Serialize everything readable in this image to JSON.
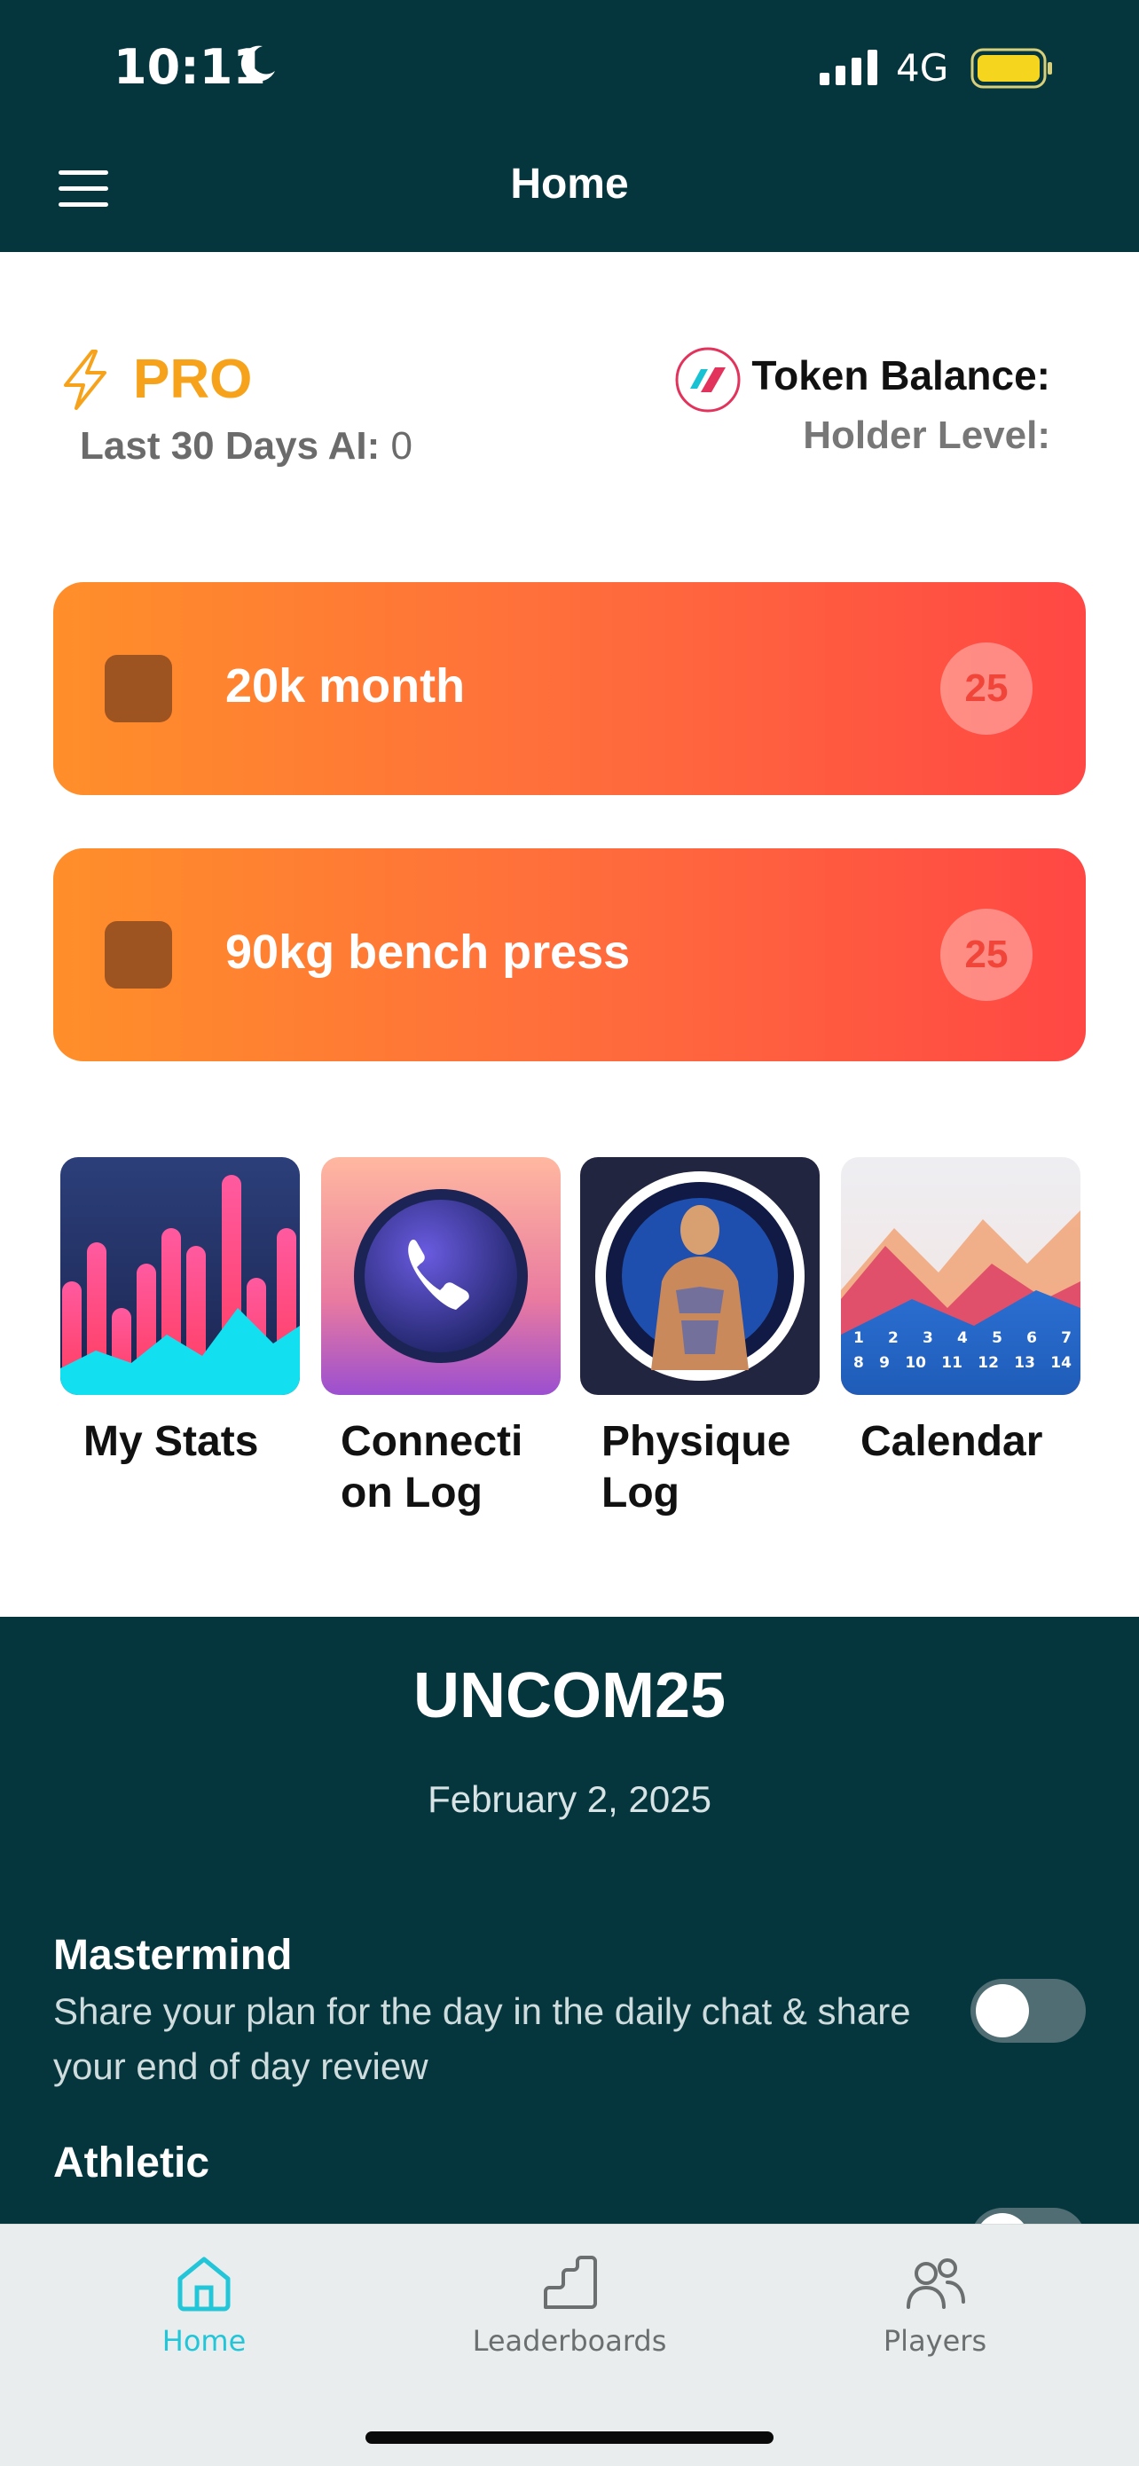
{
  "status_bar": {
    "time": "10:11",
    "network": "4G"
  },
  "header": {
    "title": "Home"
  },
  "pro_panel": {
    "badge": "PRO",
    "ai_label": "Last 30 Days AI:",
    "ai_value": "0",
    "token_balance_label": "Token Balance:",
    "holder_level_label": "Holder Level:"
  },
  "goals": [
    {
      "label": "20k month",
      "count": "25"
    },
    {
      "label": "90kg bench press",
      "count": "25"
    }
  ],
  "tiles": [
    {
      "label": "My Stats"
    },
    {
      "label": "Connecti\non Log"
    },
    {
      "label": "Physique\nLog"
    },
    {
      "label": "Calendar"
    }
  ],
  "calendar_days": [
    "1",
    "2",
    "3",
    "4",
    "5",
    "6",
    "7",
    "8",
    "9",
    "10",
    "11",
    "12",
    "13",
    "14"
  ],
  "challenge": {
    "title": "UNCOM25",
    "date": "February 2, 2025",
    "tasks": [
      {
        "title": "Mastermind",
        "description": "Share your plan for the day in the daily chat & share your end of day review"
      },
      {
        "title": "Athletic"
      }
    ]
  },
  "tabbar": {
    "tabs": [
      {
        "label": "Home",
        "icon": "home-icon",
        "active": true
      },
      {
        "label": "Leaderboards",
        "icon": "stairs-icon",
        "active": false
      },
      {
        "label": "Players",
        "icon": "people-icon",
        "active": false
      }
    ]
  },
  "colors": {
    "header_bg": "#05363d",
    "pro_accent": "#f7a21b",
    "goal_gradient_start": "#ff8f2a",
    "goal_gradient_end": "#ff4744",
    "active_tab": "#22c6d8"
  }
}
